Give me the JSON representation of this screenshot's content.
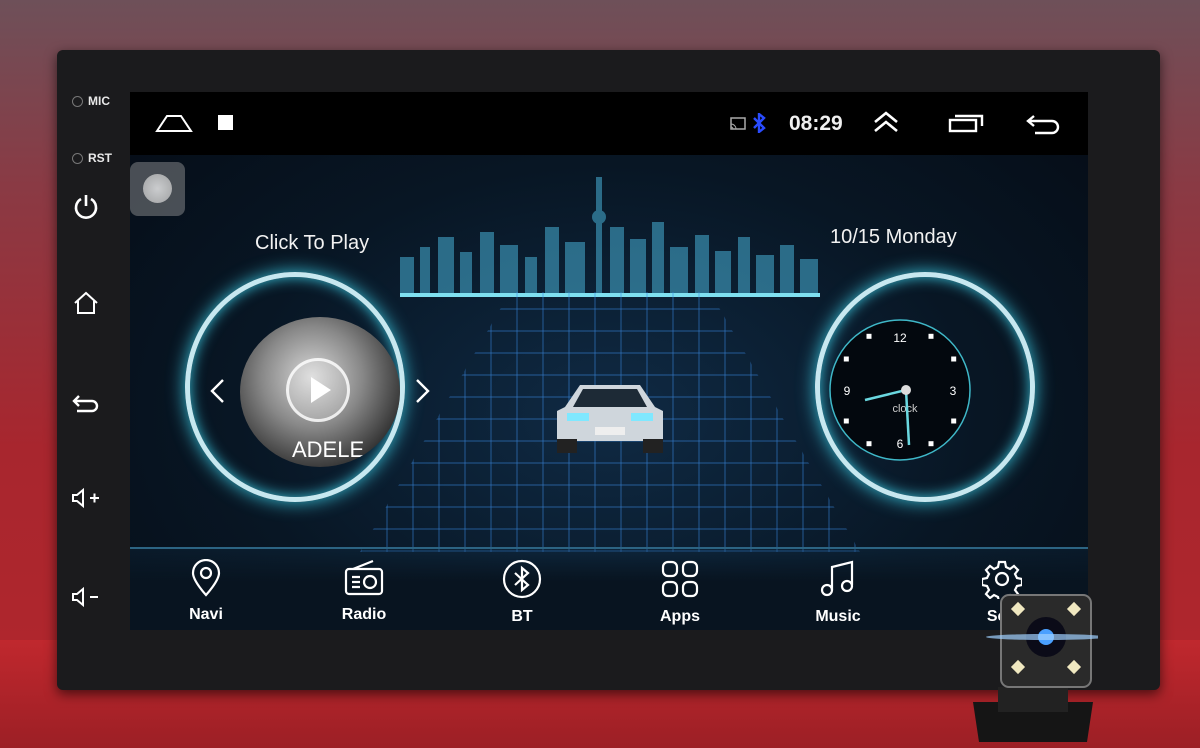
{
  "bezel": {
    "mic_label": "MIC",
    "rst_label": "RST",
    "buttons": [
      "power-icon",
      "home-icon",
      "back-icon",
      "volume-up-icon",
      "volume-down-icon"
    ]
  },
  "status_bar": {
    "time": "08:29",
    "icons": [
      "home-outline-icon",
      "stop-square-icon",
      "cast-icon",
      "bluetooth-icon",
      "double-chevron-up-icon",
      "recent-apps-icon",
      "back-arrow-icon"
    ],
    "bluetooth_color": "#2a4cff"
  },
  "music_widget": {
    "title": "Click To Play",
    "album_text": "ADELE"
  },
  "clock_widget": {
    "date": "10/15 Monday",
    "numerals": [
      "12",
      "3",
      "6",
      "9"
    ],
    "label": "clock"
  },
  "dock": {
    "apps": [
      {
        "label": "Navi",
        "icon": "location-pin-icon"
      },
      {
        "label": "Radio",
        "icon": "radio-icon"
      },
      {
        "label": "BT",
        "icon": "bluetooth-icon"
      },
      {
        "label": "Apps",
        "icon": "apps-grid-icon"
      },
      {
        "label": "Music",
        "icon": "music-note-icon"
      },
      {
        "label": "Sett",
        "icon": "settings-gear-icon"
      }
    ]
  },
  "colors": {
    "accent": "#39c0d8",
    "background": "#a8262e"
  }
}
